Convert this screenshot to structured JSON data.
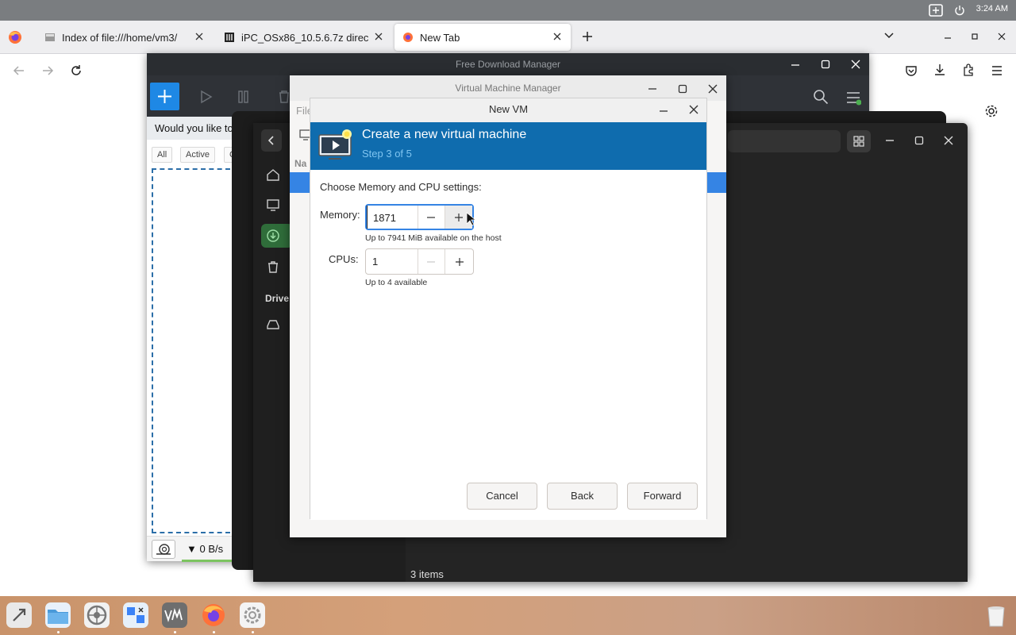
{
  "system_bar": {
    "time": "3:24 AM"
  },
  "browser": {
    "tabs": [
      {
        "label": "Index of file:///home/vm3/"
      },
      {
        "label": "iPC_OSx86_10.5.6.7z direc"
      },
      {
        "label": "New Tab"
      }
    ]
  },
  "fdm": {
    "title": "Free Download Manager",
    "banner": "Would you like to mak",
    "filters": [
      "All",
      "Active",
      "Compl"
    ],
    "speed": "▼ 0 B/s"
  },
  "files": {
    "drives_label": "Drive",
    "status": "3 items"
  },
  "vmm": {
    "title": "Virtual Machine Manager",
    "partial_label": "File",
    "partial_col": "Na"
  },
  "dialog": {
    "title": "New VM",
    "header_title": "Create a new virtual machine",
    "step": "Step 3 of 5",
    "section": "Choose Memory and CPU settings:",
    "memory_label": "Memory:",
    "memory_value": "1871",
    "memory_hint": "Up to 7941 MiB available on the host",
    "cpus_label": "CPUs:",
    "cpus_value": "1",
    "cpus_hint": "Up to 4 available",
    "cancel": "Cancel",
    "back": "Back",
    "forward": "Forward"
  },
  "colors": {
    "accent": "#0f6cae",
    "step_text": "#7fc4f0",
    "fdm_add": "#1e88e5",
    "selection": "#3584e4"
  },
  "dock": {
    "icons": [
      "launchpad-icon",
      "files-icon",
      "settings-icon",
      "screenshot-icon",
      "vm-manager-icon",
      "firefox-icon",
      "gear-app-icon",
      "trash-icon"
    ]
  }
}
